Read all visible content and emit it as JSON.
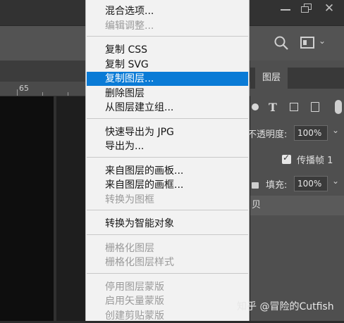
{
  "ruler": {
    "number": "65"
  },
  "menu": {
    "groups": [
      [
        {
          "label": "混合选项...",
          "enabled": true
        },
        {
          "label": "编辑调整...",
          "enabled": false
        }
      ],
      [
        {
          "label": "复制 CSS",
          "enabled": true
        },
        {
          "label": "复制 SVG",
          "enabled": true
        },
        {
          "label": "复制图层...",
          "enabled": true,
          "highlighted": true
        },
        {
          "label": "删除图层",
          "enabled": true
        },
        {
          "label": "从图层建立组...",
          "enabled": true
        }
      ],
      [
        {
          "label": "快速导出为 JPG",
          "enabled": true
        },
        {
          "label": "导出为...",
          "enabled": true
        }
      ],
      [
        {
          "label": "来自图层的画板...",
          "enabled": true
        },
        {
          "label": "来自图层的画框...",
          "enabled": true
        },
        {
          "label": "转换为图框",
          "enabled": false
        }
      ],
      [
        {
          "label": "转换为智能对象",
          "enabled": true
        }
      ],
      [
        {
          "label": "栅格化图层",
          "enabled": false
        },
        {
          "label": "栅格化图层样式",
          "enabled": false
        }
      ],
      [
        {
          "label": "停用图层蒙版",
          "enabled": false
        },
        {
          "label": "启用矢量蒙版",
          "enabled": false
        },
        {
          "label": "创建剪贴蒙版",
          "enabled": false
        }
      ]
    ]
  },
  "panel": {
    "tab_label": "图层",
    "opacity_label": "不透明度:",
    "opacity_value": "100%",
    "propagate_label": "传播帧 1",
    "fill_label": "填充:",
    "fill_value": "100%",
    "layer_fragment": "贝"
  },
  "watermark": "知乎 @冒险的Cutfish",
  "colors": {
    "highlight": "#0a7bd6",
    "menu_bg": "#f2f2f2",
    "panel_bg": "#4f4f4f"
  }
}
